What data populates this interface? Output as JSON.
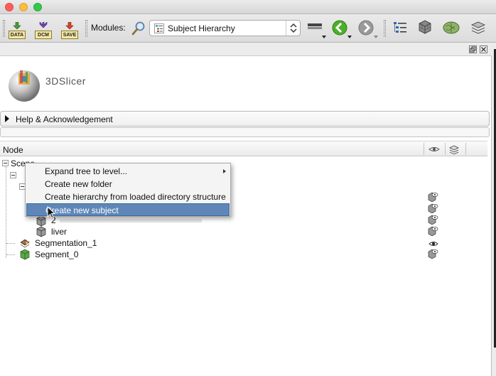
{
  "toolbar": {
    "data_label": "DATA",
    "dcm_label": "DCM",
    "save_label": "SAVE",
    "modules_label": "Modules:",
    "module_selected": "Subject Hierarchy"
  },
  "logo": {
    "text": "3DSlicer"
  },
  "help": {
    "label": "Help & Acknowledgement"
  },
  "tree": {
    "header": {
      "node": "Node"
    },
    "nodes": {
      "scene": "Scene",
      "child2": "2",
      "liver": "liver",
      "segmentation1": "Segmentation_1",
      "segment0": "Segment_0"
    }
  },
  "context_menu": {
    "items": [
      {
        "label": "Expand tree to level...",
        "submenu": true
      },
      {
        "label": "Create new folder"
      },
      {
        "label": "Create hierarchy from loaded directory structure"
      },
      {
        "label": "Create new subject",
        "selected": true
      }
    ]
  },
  "colors": {
    "menu_highlight": "#5e87b8",
    "nav_green": "#4caf2a",
    "nav_gray": "#9a9a9a"
  },
  "icons": [
    "data-icon",
    "dcm-icon",
    "save-icon",
    "search-icon",
    "layout-icon",
    "back-arrow-icon",
    "forward-arrow-icon",
    "list-icon",
    "volume-icon",
    "brain-icon",
    "slices-icon",
    "eye-icon"
  ]
}
